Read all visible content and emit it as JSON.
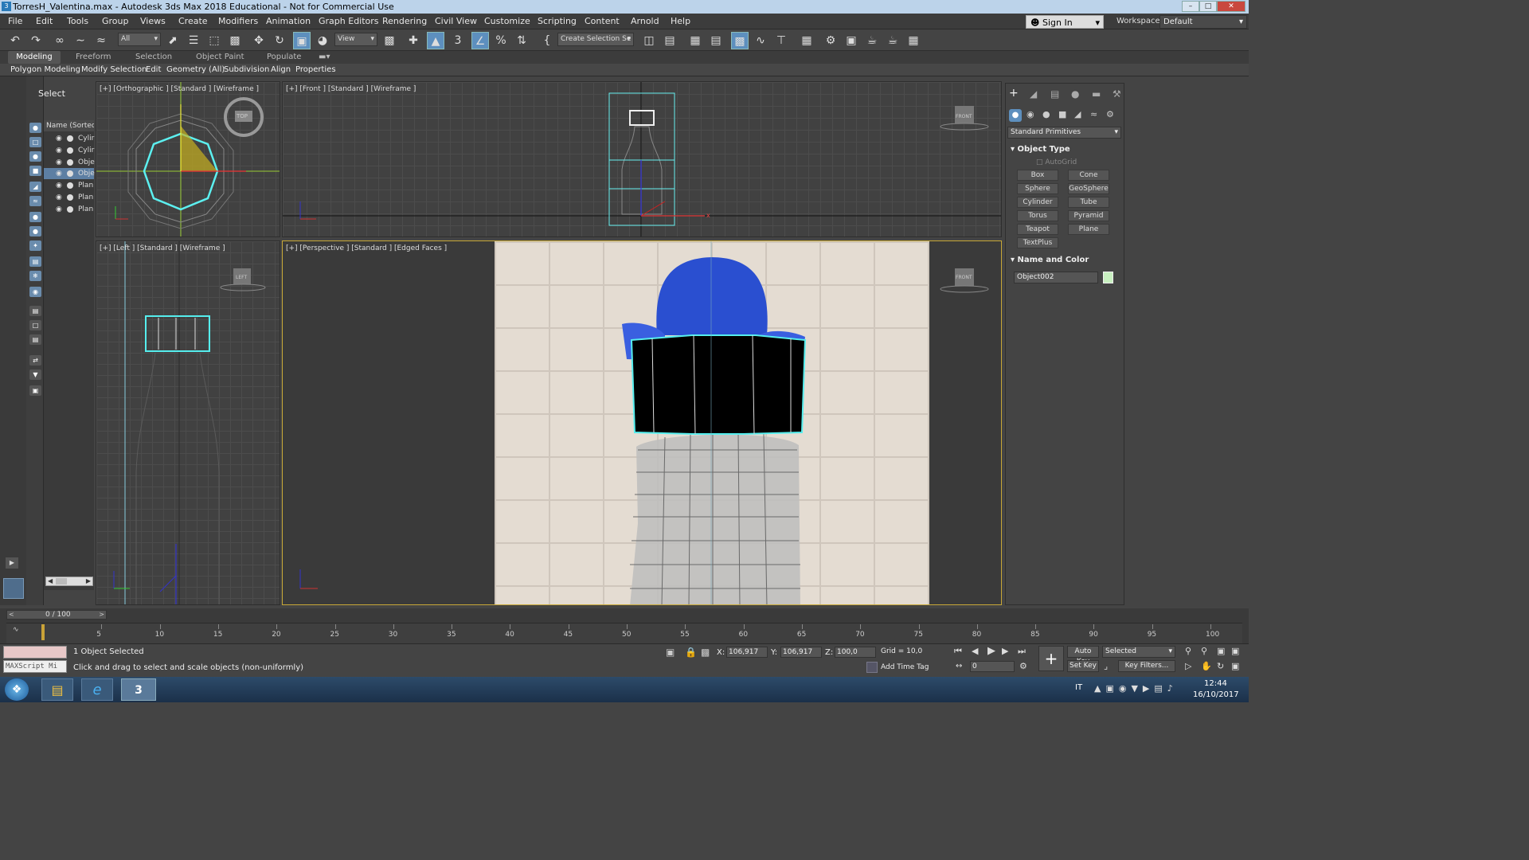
{
  "window": {
    "title": "TorresH_Valentina.max - Autodesk 3ds Max 2018 Educational - Not for Commercial Use",
    "app_icon": "3"
  },
  "menu": [
    "File",
    "Edit",
    "Tools",
    "Group",
    "Views",
    "Create",
    "Modifiers",
    "Animation",
    "Graph Editors",
    "Rendering",
    "Civil View",
    "Customize",
    "Scripting",
    "Content",
    "Arnold",
    "Help"
  ],
  "account": {
    "sign_in": "Sign In",
    "workspaces_label": "Workspaces:",
    "workspace": "Default"
  },
  "toolbar": {
    "filter": "All",
    "view": "View",
    "selection_set": "Create Selection Se"
  },
  "ribbon": {
    "tabs": [
      "Modeling",
      "Freeform",
      "Selection",
      "Object Paint",
      "Populate"
    ],
    "subtabs": [
      "Polygon Modeling",
      "Modify Selection",
      "Edit",
      "Geometry (All)",
      "Subdivision",
      "Align",
      "Properties"
    ]
  },
  "scene_explorer": {
    "title": "Select",
    "header": "Name (Sorted A",
    "items": [
      "Cylir",
      "Cylir",
      "Obje",
      "Obje",
      "Plan",
      "Plan",
      "Plan"
    ]
  },
  "viewports": {
    "top": {
      "label": "[+] [Orthographic ] [Standard ] [Wireframe ]",
      "cube": "TOP"
    },
    "front": {
      "label": "[+] [Front ] [Standard ] [Wireframe ]",
      "cube": "FRONT"
    },
    "left": {
      "label": "[+] [Left ] [Standard ] [Wireframe ]",
      "cube": "LEFT"
    },
    "persp": {
      "label": "[+] [Perspective ] [Standard ] [Edged Faces ]",
      "cube": "FRONT"
    }
  },
  "command_panel": {
    "category": "Standard Primitives",
    "object_type_title": "Object Type",
    "autogrid": "AutoGrid",
    "buttons": [
      "Box",
      "Cone",
      "Sphere",
      "GeoSphere",
      "Cylinder",
      "Tube",
      "Torus",
      "Pyramid",
      "Teapot",
      "Plane",
      "TextPlus"
    ],
    "name_color_title": "Name and Color",
    "object_name": "Object002",
    "object_color": "#c8f0c0"
  },
  "timeline": {
    "frame": "0 / 100",
    "ticks": [
      "5",
      "10",
      "15",
      "20",
      "25",
      "30",
      "35",
      "40",
      "45",
      "50",
      "55",
      "60",
      "65",
      "70",
      "75",
      "80",
      "85",
      "90",
      "95",
      "100"
    ]
  },
  "status": {
    "maxscript": "MAXScript Mi",
    "selected": "1 Object Selected",
    "prompt": "Click and drag to select and scale objects (non-uniformly)",
    "x_label": "X:",
    "x": "106,917",
    "y_label": "Y:",
    "y": "106,917",
    "z_label": "Z:",
    "z": "100,0",
    "grid": "Grid = 10,0",
    "add_time_tag": "Add Time Tag",
    "auto_key": "Auto Key",
    "set_key": "Set Key",
    "key_mode": "Selected",
    "key_filters": "Key Filters...",
    "frame_field": "0"
  },
  "taskbar": {
    "lang": "IT",
    "time": "12:44",
    "date": "16/10/2017"
  }
}
